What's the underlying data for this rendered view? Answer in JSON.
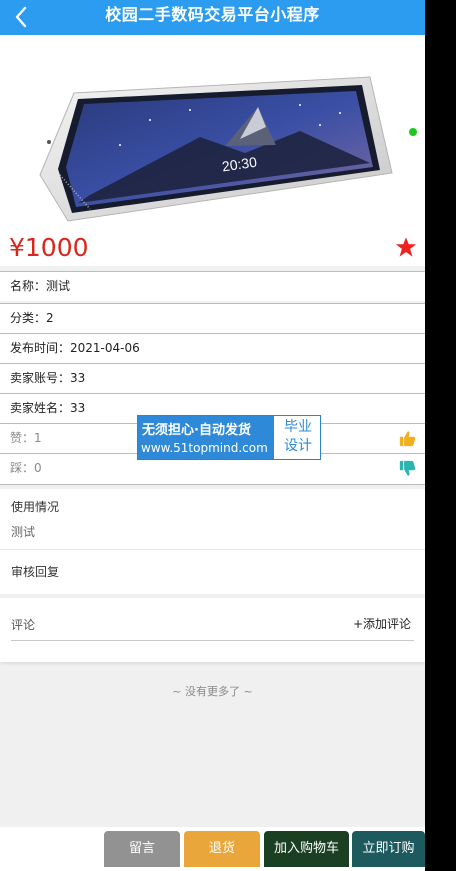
{
  "header": {
    "title": "校园二手数码交易平台小程序"
  },
  "product": {
    "price": "¥1000",
    "device_time": "20:30",
    "fields": [
      {
        "text": "名称：测试"
      },
      {
        "text": "分类：2"
      },
      {
        "text": "发布时间：2021-04-06"
      },
      {
        "text": "卖家账号：33"
      },
      {
        "text": "卖家姓名：33"
      }
    ],
    "likes": "赞：1",
    "dislikes": "踩：0"
  },
  "usage": {
    "title": "使用情况",
    "body": "测试"
  },
  "review": {
    "title": "审核回复"
  },
  "comments": {
    "label": "评论",
    "add": "+添加评论"
  },
  "list_end": "~ 没有更多了 ~",
  "actions": [
    {
      "label": "留言",
      "color": "#929292"
    },
    {
      "label": "退货",
      "color": "#e9a63a"
    },
    {
      "label": "加入购物车",
      "color": "#1b3f22"
    },
    {
      "label": "立即订购",
      "color": "#1d5a5e"
    }
  ],
  "watermark": {
    "line1": "无须担心·自动发货",
    "line2": "www.51topmind.com",
    "right1": "毕业",
    "right2": "设计"
  },
  "colors": {
    "header": "#2b9cf0",
    "price": "#d9261c",
    "star": "#ef2020",
    "thumb_up": "#f2b01e",
    "thumb_down": "#2ab5b0"
  }
}
